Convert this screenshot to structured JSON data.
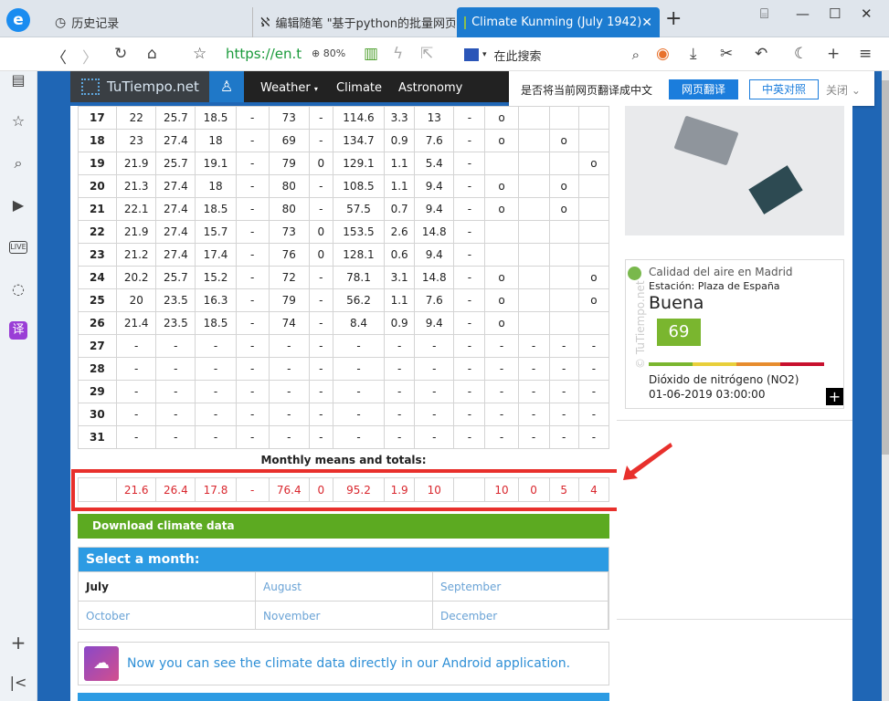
{
  "browser": {
    "tabs": [
      {
        "label": "历史记录"
      },
      {
        "label": "编辑随笔 \"基于python的批量网页"
      },
      {
        "label": "Climate Kunming (July 1942)"
      }
    ],
    "url": "https://en.t",
    "zoom": "80%",
    "search_placeholder": "在此搜索"
  },
  "site": {
    "logo": "TuTiempo.net",
    "nav": [
      "Weather",
      "Climate",
      "Astronomy"
    ]
  },
  "translate_bar": {
    "question": "是否将当前网页翻译成中文",
    "translate": "网页翻译",
    "compare": "中英对照",
    "close": "关闭"
  },
  "table": {
    "rows": [
      [
        "17",
        "22",
        "25.7",
        "18.5",
        "-",
        "73",
        "-",
        "114.6",
        "3.3",
        "13",
        "-",
        "o",
        "",
        "",
        ""
      ],
      [
        "18",
        "23",
        "27.4",
        "18",
        "-",
        "69",
        "-",
        "134.7",
        "0.9",
        "7.6",
        "-",
        "o",
        "",
        "o",
        ""
      ],
      [
        "19",
        "21.9",
        "25.7",
        "19.1",
        "-",
        "79",
        "0",
        "129.1",
        "1.1",
        "5.4",
        "-",
        "",
        "",
        "",
        "o"
      ],
      [
        "20",
        "21.3",
        "27.4",
        "18",
        "-",
        "80",
        "-",
        "108.5",
        "1.1",
        "9.4",
        "-",
        "o",
        "",
        "o",
        ""
      ],
      [
        "21",
        "22.1",
        "27.4",
        "18.5",
        "-",
        "80",
        "-",
        "57.5",
        "0.7",
        "9.4",
        "-",
        "o",
        "",
        "o",
        ""
      ],
      [
        "22",
        "21.9",
        "27.4",
        "15.7",
        "-",
        "73",
        "0",
        "153.5",
        "2.6",
        "14.8",
        "-",
        "",
        "",
        "",
        ""
      ],
      [
        "23",
        "21.2",
        "27.4",
        "17.4",
        "-",
        "76",
        "0",
        "128.1",
        "0.6",
        "9.4",
        "-",
        "",
        "",
        "",
        ""
      ],
      [
        "24",
        "20.2",
        "25.7",
        "15.2",
        "-",
        "72",
        "-",
        "78.1",
        "3.1",
        "14.8",
        "-",
        "o",
        "",
        "",
        "o"
      ],
      [
        "25",
        "20",
        "23.5",
        "16.3",
        "-",
        "79",
        "-",
        "56.2",
        "1.1",
        "7.6",
        "-",
        "o",
        "",
        "",
        "o"
      ],
      [
        "26",
        "21.4",
        "23.5",
        "18.5",
        "-",
        "74",
        "-",
        "8.4",
        "0.9",
        "9.4",
        "-",
        "o",
        "",
        "",
        ""
      ],
      [
        "27",
        "-",
        "-",
        "-",
        "-",
        "-",
        "-",
        "-",
        "-",
        "-",
        "-",
        "-",
        "-",
        "-",
        "-"
      ],
      [
        "28",
        "-",
        "-",
        "-",
        "-",
        "-",
        "-",
        "-",
        "-",
        "-",
        "-",
        "-",
        "-",
        "-",
        "-"
      ],
      [
        "29",
        "-",
        "-",
        "-",
        "-",
        "-",
        "-",
        "-",
        "-",
        "-",
        "-",
        "-",
        "-",
        "-",
        "-"
      ],
      [
        "30",
        "-",
        "-",
        "-",
        "-",
        "-",
        "-",
        "-",
        "-",
        "-",
        "-",
        "-",
        "-",
        "-",
        "-"
      ],
      [
        "31",
        "-",
        "-",
        "-",
        "-",
        "-",
        "-",
        "-",
        "-",
        "-",
        "-",
        "-",
        "-",
        "-",
        "-"
      ]
    ],
    "means_label": "Monthly means and totals:",
    "means": [
      "",
      "21.6",
      "26.4",
      "17.8",
      "-",
      "76.4",
      "0",
      "95.2",
      "1.9",
      "10",
      "",
      "10",
      "0",
      "5",
      "4"
    ]
  },
  "download_label": "Download climate data",
  "months": {
    "heading": "Select a month:",
    "items": [
      "July",
      "August",
      "September",
      "October",
      "November",
      "December"
    ]
  },
  "app_banner": "Now you can see the climate data directly in our Android application.",
  "air_quality": {
    "title": "Calidad del aire en Madrid",
    "station": "Estación: Plaza de España",
    "quality": "Buena",
    "value": "69",
    "pollutant": "Dióxido de nitrógeno (NO2)",
    "time": "01-06-2019 03:00:00",
    "side_label": "© TuTiempo.net"
  },
  "colors": {
    "accent_blue": "#1c7bd0",
    "means_red": "#d9272e",
    "highlight_red": "#e8302c",
    "download_green": "#5caa21"
  }
}
